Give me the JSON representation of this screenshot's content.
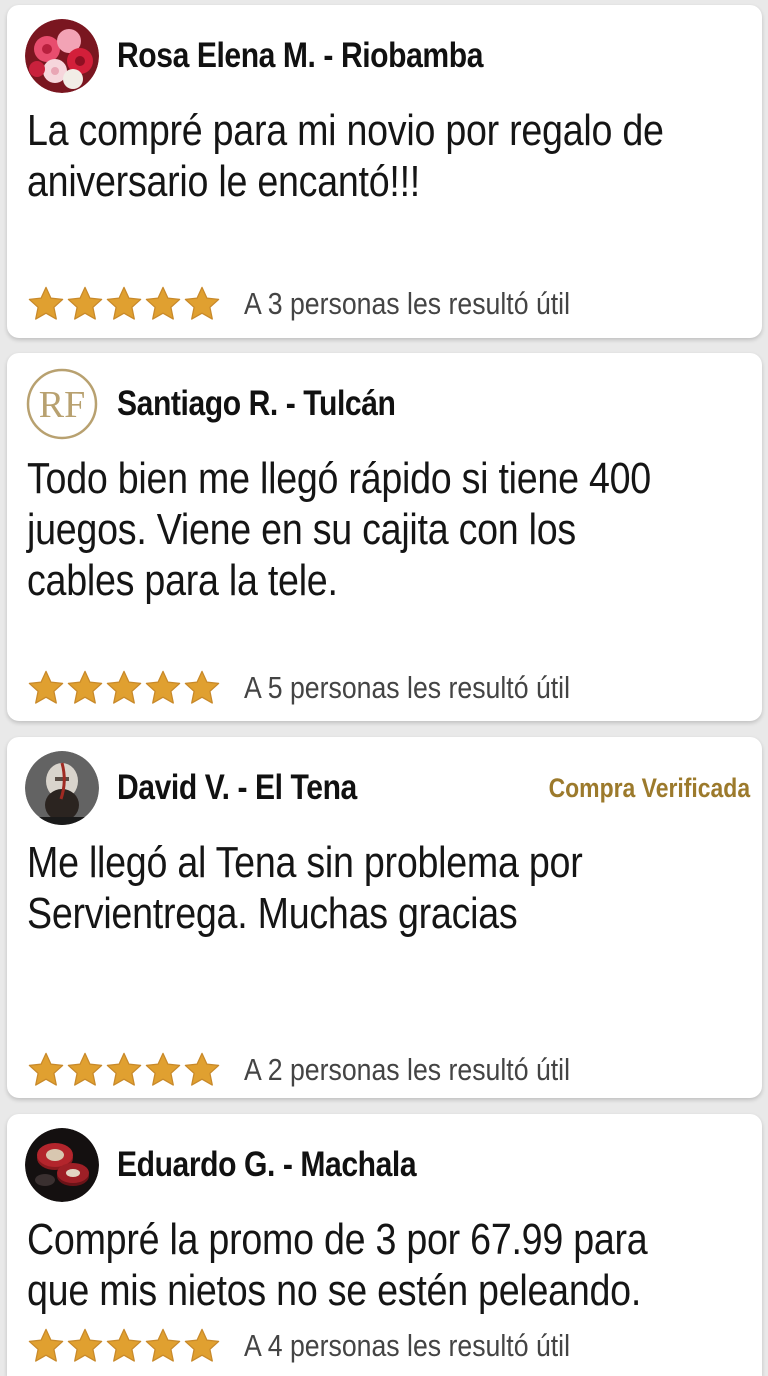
{
  "colors": {
    "star": "#e0a030",
    "star_stroke": "#c8892a",
    "badge": "#9c7a2c",
    "rf_gold": "#b8a170"
  },
  "reviews": [
    {
      "author": "Rosa Elena M. - Riobamba",
      "avatar_icon": "roses-avatar",
      "text_lines": [
        "La compré para mi novio por regalo de",
        "aniversario le encantó!!!"
      ],
      "rating": 5,
      "helpful": "A 3 personas les resultó útil",
      "badge": ""
    },
    {
      "author": "Santiago R. - Tulcán",
      "avatar_icon": "rf-monogram-avatar",
      "text_lines": [
        "Todo bien me llegó rápido si tiene 400",
        "juegos. Viene en su cajita con los",
        "cables para la tele."
      ],
      "rating": 5,
      "helpful": "A 5 personas les resultó útil",
      "badge": ""
    },
    {
      "author": "David V. - El Tena",
      "avatar_icon": "warrior-avatar",
      "text_lines": [
        "Me llegó al Tena sin problema por",
        "Servientrega. Muchas gracias"
      ],
      "rating": 5,
      "helpful": "A 2 personas les resultó útil",
      "badge": "Compra Verificada"
    },
    {
      "author": "Eduardo G. - Machala",
      "avatar_icon": "poker-chips-avatar",
      "text_lines": [
        "Compré la promo de 3 por 67.99 para",
        "que mis nietos no se estén peleando."
      ],
      "rating": 5,
      "helpful": "A 4 personas les resultó útil",
      "badge": ""
    }
  ]
}
